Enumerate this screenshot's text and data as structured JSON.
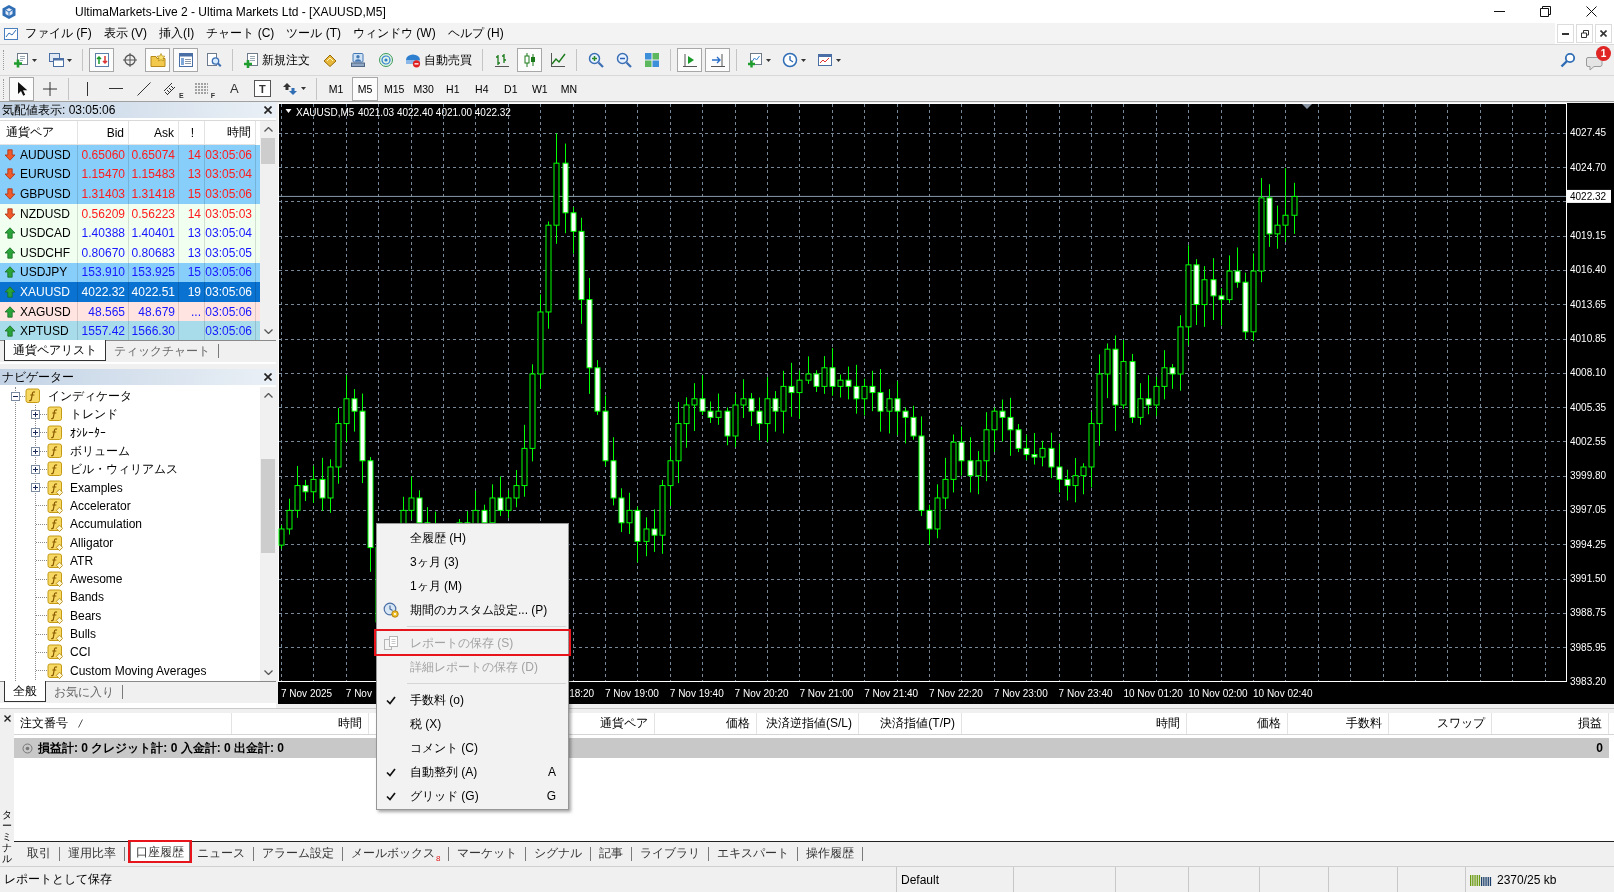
{
  "window": {
    "title": "UltimaMarkets-Live 2 - Ultima Markets Ltd - [XAUUSD,M5]"
  },
  "menu": [
    "ファイル (F)",
    "表示 (V)",
    "挿入(I)",
    "チャート (C)",
    "ツール (T)",
    "ウィンドウ (W)",
    "ヘルプ (H)"
  ],
  "toolbar": {
    "window_toggles": [
      {
        "on": true
      },
      {
        "on": false
      },
      {
        "on": true
      },
      {
        "on": true
      },
      {
        "on": false
      }
    ],
    "new_order": "新規注文",
    "auto_trading": "自動売買",
    "chart_types": [
      {
        "selected": false
      },
      {
        "selected": true
      },
      {
        "selected": false
      }
    ],
    "chart_options": [
      {
        "on": true
      },
      {
        "on": true
      }
    ],
    "notification_count": "1"
  },
  "drawing_toolbar": {
    "tools": [
      {
        "selected": true
      },
      {
        "selected": false
      }
    ],
    "channel_mark": "E",
    "fibo_mark": "F",
    "text_tool": "A",
    "label_tool": "T",
    "timeframes": [
      {
        "label": "M1",
        "selected": false
      },
      {
        "label": "M5",
        "selected": true
      },
      {
        "label": "M15",
        "selected": false
      },
      {
        "label": "M30",
        "selected": false
      },
      {
        "label": "H1",
        "selected": false
      },
      {
        "label": "H4",
        "selected": false
      },
      {
        "label": "D1",
        "selected": false
      },
      {
        "label": "W1",
        "selected": false
      },
      {
        "label": "MN",
        "selected": false
      }
    ]
  },
  "market_watch": {
    "title": "気配値表示: 03:05:06",
    "columns": [
      "通貨ペア",
      "Bid",
      "Ask",
      "!",
      "時間"
    ],
    "rows": [
      {
        "symbol": "AUDUSD",
        "bid": "0.65060",
        "ask": "0.65074",
        "spread": "14",
        "time": "03:05:06",
        "rising": false,
        "color": "#87cefa",
        "selected": false
      },
      {
        "symbol": "EURUSD",
        "bid": "1.15470",
        "ask": "1.15483",
        "spread": "13",
        "time": "03:05:04",
        "rising": false,
        "color": "#87cefa",
        "selected": false
      },
      {
        "symbol": "GBPUSD",
        "bid": "1.31403",
        "ask": "1.31418",
        "spread": "15",
        "time": "03:05:06",
        "rising": false,
        "color": "#87cefa",
        "selected": false
      },
      {
        "symbol": "NZDUSD",
        "bid": "0.56209",
        "ask": "0.56223",
        "spread": "14",
        "time": "03:05:03",
        "rising": false,
        "color": "#f0fff0",
        "selected": false
      },
      {
        "symbol": "USDCAD",
        "bid": "1.40388",
        "ask": "1.40401",
        "spread": "13",
        "time": "03:05:04",
        "rising": true,
        "color": "#f0fff0",
        "selected": false
      },
      {
        "symbol": "USDCHF",
        "bid": "0.80670",
        "ask": "0.80683",
        "spread": "13",
        "time": "03:05:05",
        "rising": true,
        "color": "#f0fff0",
        "selected": false
      },
      {
        "symbol": "USDJPY",
        "bid": "153.910",
        "ask": "153.925",
        "spread": "15",
        "time": "03:05:06",
        "rising": true,
        "color": "#87cefa",
        "selected": false
      },
      {
        "symbol": "XAUUSD",
        "bid": "4022.32",
        "ask": "4022.51",
        "spread": "19",
        "time": "03:05:06",
        "rising": true,
        "selected": true
      },
      {
        "symbol": "XAGUSD",
        "bid": "48.565",
        "ask": "48.679",
        "spread": "...",
        "time": "03:05:06",
        "rising": true,
        "color": "#ffe4e1",
        "selected": false
      },
      {
        "symbol": "XPTUSD",
        "bid": "1557.42",
        "ask": "1566.30",
        "time": "03:05:06",
        "rising": true,
        "color": "#a8dcea",
        "selected": false
      }
    ],
    "tabs": [
      {
        "label": "通貨ペアリスト",
        "selected": true
      },
      {
        "label": "ティックチャート",
        "selected": false
      }
    ]
  },
  "navigator": {
    "title": "ナビゲーター",
    "tree": {
      "label": "インディケータ",
      "expanded": true,
      "children": [
        {
          "label": "トレンド",
          "kind": "builtin",
          "expanded": false
        },
        {
          "label": "ｵｼﾚｰﾀｰ",
          "kind": "builtin",
          "expanded": false
        },
        {
          "label": "ボリューム",
          "kind": "builtin",
          "expanded": false
        },
        {
          "label": "ビル・ウィリアムス",
          "kind": "builtin",
          "expanded": false
        },
        {
          "label": "Examples",
          "kind": "custom",
          "expanded": false
        },
        {
          "label": "Accelerator",
          "kind": "custom"
        },
        {
          "label": "Accumulation",
          "kind": "custom"
        },
        {
          "label": "Alligator",
          "kind": "custom"
        },
        {
          "label": "ATR",
          "kind": "custom"
        },
        {
          "label": "Awesome",
          "kind": "custom"
        },
        {
          "label": "Bands",
          "kind": "custom"
        },
        {
          "label": "Bears",
          "kind": "custom"
        },
        {
          "label": "Bulls",
          "kind": "custom"
        },
        {
          "label": "CCI",
          "kind": "custom"
        },
        {
          "label": "Custom Moving Averages",
          "kind": "custom"
        }
      ]
    },
    "tabs": [
      {
        "label": "全般",
        "selected": true
      },
      {
        "label": "お気に入り",
        "selected": false
      }
    ]
  },
  "chart": {
    "symbol": "XAUUSD,M5",
    "ohlc": "4021.03 4022.40 4021.00 4022.32",
    "price_axis": [
      "4027.45",
      "4024.70",
      "4019.15",
      "4016.40",
      "4013.65",
      "4010.85",
      "4008.10",
      "4005.35",
      "4002.55",
      "3999.80",
      "3997.05",
      "3994.25",
      "3991.50",
      "3988.75",
      "3985.95",
      "3983.20"
    ],
    "current_price": "4022.32",
    "time_axis": [
      "7 Nov 2025",
      "7 Nov",
      "18:20",
      "7 Nov 19:00",
      "7 Nov 19:40",
      "7 Nov 20:20",
      "7 Nov 21:00",
      "7 Nov 21:40",
      "7 Nov 22:20",
      "7 Nov 23:00",
      "7 Nov 23:40",
      "10 Nov 01:20",
      "10 Nov 02:00",
      "10 Nov 02:40"
    ]
  },
  "context_menu": {
    "items": [
      {
        "kind": "item",
        "label": "全履歴 (H)",
        "checked": false,
        "disabled": false,
        "annotated": false
      },
      {
        "kind": "item",
        "label": "3ヶ月 (3)",
        "checked": false,
        "disabled": false,
        "annotated": false
      },
      {
        "kind": "item",
        "label": "1ヶ月 (M)",
        "checked": false,
        "disabled": false,
        "annotated": false
      },
      {
        "kind": "item",
        "label": "期間のカスタム設定... (P)",
        "checked": false,
        "disabled": false,
        "annotated": false
      },
      {
        "kind": "separator"
      },
      {
        "kind": "item",
        "label": "レポートの保存 (S)",
        "checked": false,
        "disabled": true,
        "annotated": true
      },
      {
        "kind": "item",
        "label": "詳細レポートの保存 (D)",
        "checked": false,
        "disabled": true,
        "annotated": false
      },
      {
        "kind": "separator"
      },
      {
        "kind": "item",
        "label": "手数料 (o)",
        "checked": true,
        "disabled": false,
        "annotated": false
      },
      {
        "kind": "item",
        "label": "税 (X)",
        "checked": false,
        "disabled": false,
        "annotated": false
      },
      {
        "kind": "item",
        "label": "コメント (C)",
        "checked": false,
        "disabled": false,
        "annotated": false
      },
      {
        "kind": "item",
        "label": "自動整列 (A)",
        "checked": true,
        "disabled": false,
        "annotated": false,
        "shortcut": "A"
      },
      {
        "kind": "item",
        "label": "グリッド (G)",
        "checked": true,
        "disabled": false,
        "annotated": false,
        "shortcut": "G"
      }
    ]
  },
  "terminal": {
    "title": "ターミナル",
    "columns": [
      {
        "label": "注文番号",
        "sorted": true
      },
      {
        "label": "時間",
        "sorted": false
      },
      {
        "label": "通貨ペア",
        "sorted": false
      },
      {
        "label": "価格",
        "sorted": false
      },
      {
        "label": "決済逆指値(S/L)",
        "sorted": false
      },
      {
        "label": "決済指値(T/P)",
        "sorted": false
      },
      {
        "label": "時間",
        "sorted": false
      },
      {
        "label": "価格",
        "sorted": false
      },
      {
        "label": "手数料",
        "sorted": false
      },
      {
        "label": "スワップ",
        "sorted": false
      },
      {
        "label": "損益",
        "sorted": false
      }
    ],
    "summary": "損益計: 0 クレジット計: 0 入金計: 0 出金計: 0",
    "total": "0",
    "tabs": [
      {
        "label": "取引",
        "selected": false,
        "annotated": false
      },
      {
        "label": "運用比率",
        "selected": false,
        "annotated": false
      },
      {
        "label": "口座履歴",
        "selected": true,
        "annotated": true
      },
      {
        "label": "ニュース",
        "selected": false,
        "annotated": false
      },
      {
        "label": "アラーム設定",
        "selected": false,
        "annotated": false
      },
      {
        "label": "メールボックス",
        "selected": false,
        "annotated": false,
        "badge": "8"
      },
      {
        "label": "マーケット",
        "selected": false,
        "annotated": false
      },
      {
        "label": "シグナル",
        "selected": false,
        "annotated": false
      },
      {
        "label": "記事",
        "selected": false,
        "annotated": false
      },
      {
        "label": "ライブラリ",
        "selected": false,
        "annotated": false
      },
      {
        "label": "エキスパート",
        "selected": false,
        "annotated": false
      },
      {
        "label": "操作履歴",
        "selected": false,
        "annotated": false
      }
    ]
  },
  "status_bar": {
    "message": "レポートとして保存",
    "profile": "Default",
    "traffic": "2370/25 kb"
  }
}
